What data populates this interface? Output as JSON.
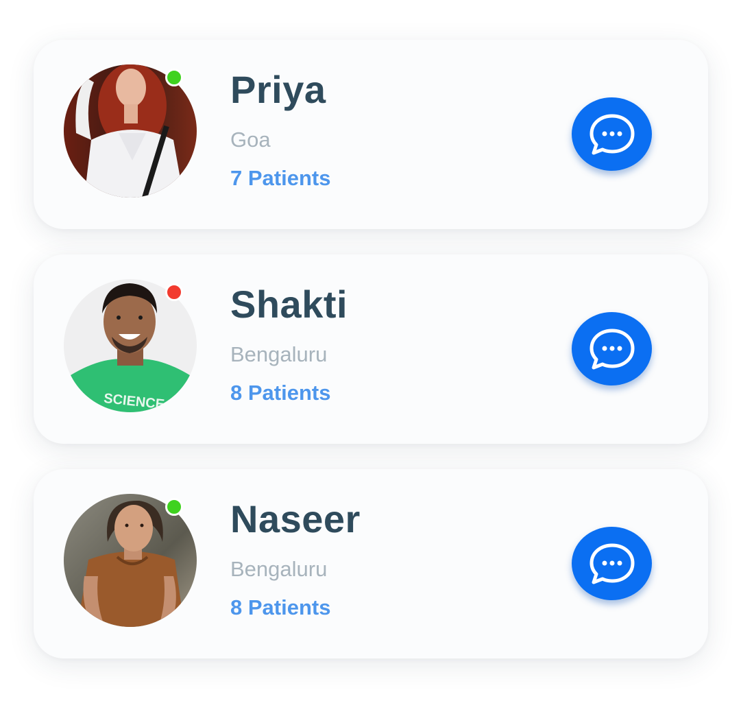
{
  "contacts": [
    {
      "name": "Priya",
      "city": "Goa",
      "patients": "7 Patients",
      "status": "online",
      "status_color": "#3fd21f"
    },
    {
      "name": "Shakti",
      "city": "Bengaluru",
      "patients": "8 Patients",
      "status": "busy",
      "status_color": "#f23a2e"
    },
    {
      "name": "Naseer",
      "city": "Bengaluru",
      "patients": "8 Patients",
      "status": "online",
      "status_color": "#3fd21f"
    }
  ],
  "colors": {
    "name_text": "#2f4b5c",
    "city_text": "#a7b3bc",
    "patients_text": "#4d96ec",
    "chat_button": "#0b6ff2"
  },
  "icons": {
    "chat_button_icon": "chat-bubble-dots-icon"
  }
}
